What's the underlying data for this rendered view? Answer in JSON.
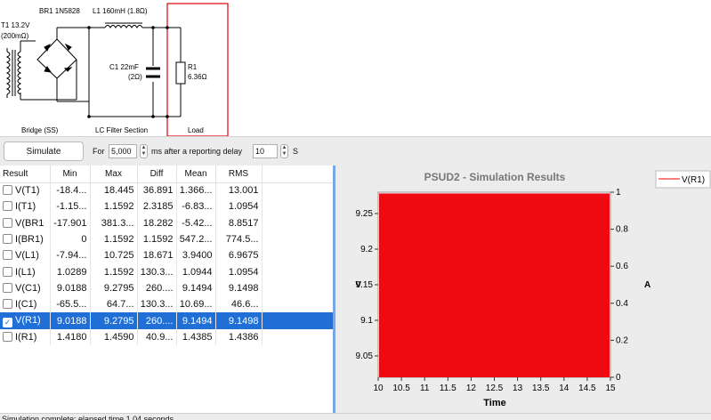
{
  "schematic": {
    "transformer_label": "T1 13.2V",
    "transformer_res": "(200mΩ)",
    "bridge_label": "BR1 1N5828",
    "inductor_label": "L1 160mH (1.8Ω)",
    "capacitor_label": "C1 22mF",
    "capacitor_res": "(2Ω)",
    "resistor_label": "R1",
    "resistor_value": "6.36Ω",
    "section_bridge": "Bridge (SS)",
    "section_filter": "LC Filter Section",
    "section_load": "Load"
  },
  "toolbar": {
    "simulate_label": "Simulate",
    "for_label": "For",
    "for_value": "5,000",
    "ms_label": "ms after a reporting delay",
    "delay_value": "10",
    "s_label": "S"
  },
  "results": {
    "headers": [
      "Result",
      "Min",
      "Max",
      "Diff",
      "Mean",
      "RMS"
    ],
    "rows": [
      {
        "name": "V(T1)",
        "min": "-18.4...",
        "max": "18.445",
        "diff": "36.891",
        "mean": "1.366...",
        "rms": "13.001",
        "checked": false
      },
      {
        "name": "I(T1)",
        "min": "-1.15...",
        "max": "1.1592",
        "diff": "2.3185",
        "mean": "-6.83...",
        "rms": "1.0954",
        "checked": false
      },
      {
        "name": "V(BR1",
        "min": "-17.901",
        "max": "381.3...",
        "diff": "18.282",
        "mean": "-5.42...",
        "rms": "8.8517",
        "checked": false
      },
      {
        "name": "I(BR1)",
        "min": "0",
        "max": "1.1592",
        "diff": "1.1592",
        "mean": "547.2...",
        "rms": "774.5...",
        "checked": false
      },
      {
        "name": "V(L1)",
        "min": "-7.94...",
        "max": "10.725",
        "diff": "18.671",
        "mean": "3.9400",
        "rms": "6.9675",
        "checked": false
      },
      {
        "name": "I(L1)",
        "min": "1.0289",
        "max": "1.1592",
        "diff": "130.3...",
        "mean": "1.0944",
        "rms": "1.0954",
        "checked": false
      },
      {
        "name": "V(C1)",
        "min": "9.0188",
        "max": "9.2795",
        "diff": "260....",
        "mean": "9.1494",
        "rms": "9.1498",
        "checked": false
      },
      {
        "name": "I(C1)",
        "min": "-65.5...",
        "max": "64.7...",
        "diff": "130.3...",
        "mean": "10.69...",
        "rms": "46.6...",
        "checked": false
      },
      {
        "name": "V(R1)",
        "min": "9.0188",
        "max": "9.2795",
        "diff": "260....",
        "mean": "9.1494",
        "rms": "9.1498",
        "checked": true
      },
      {
        "name": "I(R1)",
        "min": "1.4180",
        "max": "1.4590",
        "diff": "40.9...",
        "mean": "1.4385",
        "rms": "1.4386",
        "checked": false
      }
    ]
  },
  "chart_data": {
    "type": "line",
    "title": "PSUD2 - Simulation Results",
    "xlabel": "Time",
    "ylabel": "V",
    "y2label": "A",
    "xlim": [
      10,
      15
    ],
    "ylim": [
      9.02,
      9.28
    ],
    "y2lim": [
      0,
      1
    ],
    "x_ticks": [
      10,
      10.5,
      11,
      11.5,
      12,
      12.5,
      13,
      13.5,
      14,
      14.5,
      15
    ],
    "y_ticks": [
      9.05,
      9.1,
      9.15,
      9.2,
      9.25
    ],
    "y2_ticks": [
      0,
      0.2,
      0.4,
      0.6,
      0.8,
      1
    ],
    "series": [
      {
        "name": "V(R1)",
        "color": "#ff0000",
        "min": 9.0188,
        "max": 9.2795
      }
    ],
    "legend": "top-right",
    "fill_color": "#ee0a10"
  },
  "status": {
    "text": "Simulation complete: elapsed time 1.04 seconds"
  }
}
